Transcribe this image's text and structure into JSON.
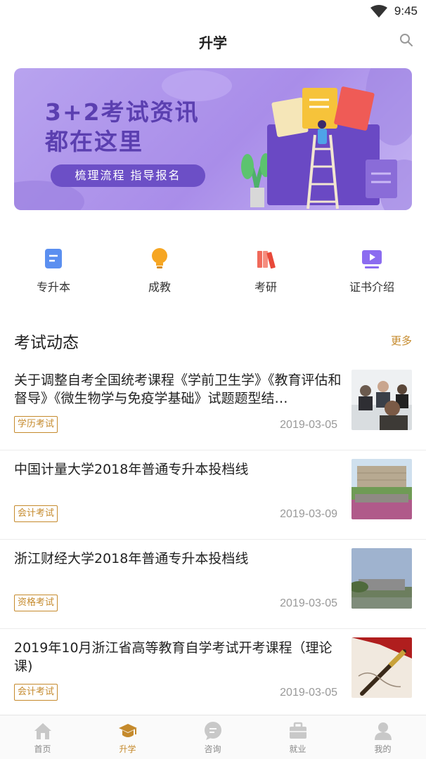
{
  "status_bar": {
    "time": "9:45"
  },
  "header": {
    "title": "升学"
  },
  "banner": {
    "title_line1": "3+2考试资讯",
    "title_line2": "都在这里",
    "subtitle": "梳理流程 指导报名"
  },
  "categories": [
    {
      "label": "专升本",
      "icon": "document-icon",
      "color": "#5b8ff0"
    },
    {
      "label": "成教",
      "icon": "lightbulb-icon",
      "color": "#f6a623"
    },
    {
      "label": "考研",
      "icon": "books-icon",
      "color": "#f06a5b"
    },
    {
      "label": "证书介绍",
      "icon": "video-play-icon",
      "color": "#8b6cf0"
    }
  ],
  "section": {
    "title": "考试动态",
    "more": "更多"
  },
  "news": [
    {
      "title": "关于调整自考全国统考课程《学前卫生学》《教育评估和督导》《微生物学与免疫学基础》试题题型结…",
      "tag": "学历考试",
      "date": "2019-03-05"
    },
    {
      "title": "中国计量大学2018年普通专升本投档线",
      "tag": "会计考试",
      "date": "2019-03-09"
    },
    {
      "title": "浙江财经大学2018年普通专升本投档线",
      "tag": "资格考试",
      "date": "2019-03-05"
    },
    {
      "title": "2019年10月浙江省高等教育自学考试开考课程（理论课)",
      "tag": "会计考试",
      "date": "2019-03-05"
    }
  ],
  "tabs": [
    {
      "label": "首页",
      "icon": "home-icon"
    },
    {
      "label": "升学",
      "icon": "graduation-cap-icon"
    },
    {
      "label": "咨询",
      "icon": "chat-bubble-icon"
    },
    {
      "label": "就业",
      "icon": "briefcase-icon"
    },
    {
      "label": "我的",
      "icon": "person-icon"
    }
  ],
  "colors": {
    "accent": "#c58a2c",
    "banner": "#a98de9",
    "divider": "#ececec"
  }
}
